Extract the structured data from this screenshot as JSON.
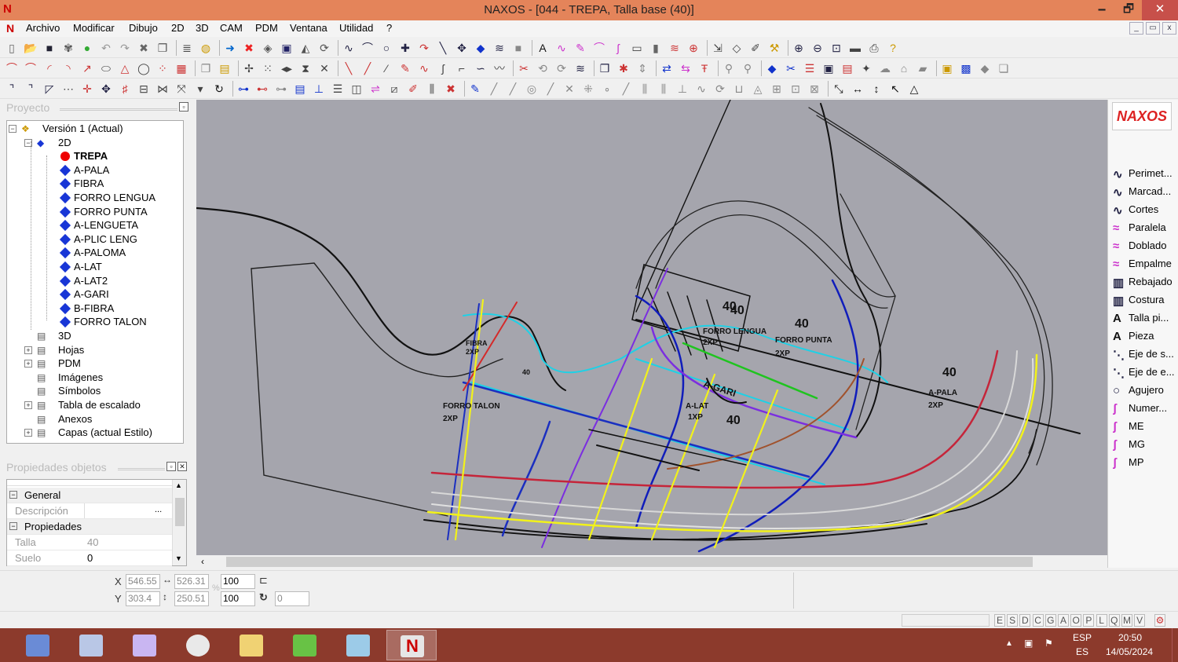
{
  "window": {
    "title": "NAXOS - [044 - TREPA, Talla base (40)]",
    "logo": "N",
    "min": "🗕",
    "max": "🗗",
    "close": "✕"
  },
  "menu": [
    "Archivo",
    "Modificar",
    "Dibujo",
    "2D",
    "3D",
    "CAM",
    "PDM",
    "Ventana",
    "Utilidad",
    "?"
  ],
  "mdi_buttons": [
    "_",
    "▭",
    "x"
  ],
  "project_panel": {
    "title": "Proyecto",
    "tree": [
      {
        "label": "Versión 1 (Actual)",
        "level": 0,
        "icon": "version-icon",
        "expander": "−"
      },
      {
        "label": "2D",
        "level": 1,
        "icon": "2d-icon",
        "expander": "−"
      },
      {
        "label": "TREPA",
        "level": 2,
        "icon": "red-dot-icon",
        "bold": true
      },
      {
        "label": "A-PALA",
        "level": 2,
        "icon": "blue-diamond-icon"
      },
      {
        "label": "FIBRA",
        "level": 2,
        "icon": "blue-diamond-icon"
      },
      {
        "label": "FORRO LENGUA",
        "level": 2,
        "icon": "blue-diamond-icon"
      },
      {
        "label": "FORRO PUNTA",
        "level": 2,
        "icon": "blue-diamond-icon"
      },
      {
        "label": "A-LENGUETA",
        "level": 2,
        "icon": "blue-diamond-icon"
      },
      {
        "label": "A-PLIC LENG",
        "level": 2,
        "icon": "blue-diamond-icon"
      },
      {
        "label": "A-PALOMA",
        "level": 2,
        "icon": "blue-diamond-icon"
      },
      {
        "label": "A-LAT",
        "level": 2,
        "icon": "blue-diamond-icon"
      },
      {
        "label": "A-LAT2",
        "level": 2,
        "icon": "blue-diamond-icon"
      },
      {
        "label": "A-GARI",
        "level": 2,
        "icon": "blue-diamond-icon"
      },
      {
        "label": "B-FIBRA",
        "level": 2,
        "icon": "blue-diamond-icon"
      },
      {
        "label": "FORRO TALON",
        "level": 2,
        "icon": "blue-diamond-icon"
      },
      {
        "label": "3D",
        "level": 1,
        "icon": "3d-icon"
      },
      {
        "label": "Hojas",
        "level": 1,
        "icon": "sheets-icon",
        "expander": "+"
      },
      {
        "label": "PDM",
        "level": 1,
        "icon": "pdm-icon",
        "expander": "+"
      },
      {
        "label": "Imágenes",
        "level": 1,
        "icon": "images-icon"
      },
      {
        "label": "Símbolos",
        "level": 1,
        "icon": "symbols-icon"
      },
      {
        "label": "Tabla de escalado",
        "level": 1,
        "icon": "scale-table-icon",
        "expander": "+"
      },
      {
        "label": "Anexos",
        "level": 1,
        "icon": "attachments-icon"
      },
      {
        "label": "Capas (actual Estilo)",
        "level": 1,
        "icon": "layers-icon",
        "expander": "+"
      }
    ]
  },
  "properties_panel": {
    "title": "Propiedades objetos",
    "sections": {
      "general": "General",
      "props": "Propiedades"
    },
    "fields": {
      "descripcion_label": "Descripción",
      "descripcion_value": "",
      "ellipsis": "...",
      "talla_label": "Talla",
      "talla_value": "40",
      "suelo_label": "Suelo",
      "suelo_value": "0"
    }
  },
  "right_panel": {
    "logo": "NAXOS",
    "items": [
      {
        "label": "Perimet...",
        "icon": "curve-icon"
      },
      {
        "label": "Marcad...",
        "icon": "curve-icon"
      },
      {
        "label": "Cortes",
        "icon": "curve-icon"
      },
      {
        "label": "Paralela",
        "icon": "parallel-icon"
      },
      {
        "label": "Doblado",
        "icon": "fold-icon"
      },
      {
        "label": "Empalme",
        "icon": "joint-icon"
      },
      {
        "label": "Rebajado",
        "icon": "pencils-icon"
      },
      {
        "label": "Costura",
        "icon": "pencils-icon"
      },
      {
        "label": "Talla pi...",
        "icon": "text-a-icon"
      },
      {
        "label": "Pieza",
        "icon": "text-a-icon"
      },
      {
        "label": "Eje de s...",
        "icon": "axis-icon"
      },
      {
        "label": "Eje de e...",
        "icon": "axis-icon"
      },
      {
        "label": "Agujero",
        "icon": "circle-icon"
      },
      {
        "label": "Numer...",
        "icon": "pen-icon"
      },
      {
        "label": "ME",
        "icon": "pen-icon"
      },
      {
        "label": "MG",
        "icon": "pen-icon"
      },
      {
        "label": "MP",
        "icon": "pen-icon"
      }
    ]
  },
  "canvas_labels": [
    {
      "text": "40",
      "cls": "size"
    },
    {
      "text": "40",
      "cls": "size"
    },
    {
      "text": "40",
      "cls": "size"
    },
    {
      "text": "40",
      "cls": "size"
    },
    {
      "text": "40",
      "cls": "size"
    },
    {
      "text": "40",
      "cls": "small"
    },
    {
      "text": "FORRO PUNTA",
      "cls": "piece"
    },
    {
      "text": "2XP",
      "cls": "piece"
    },
    {
      "text": "FORRO LENGUA",
      "cls": "piece"
    },
    {
      "text": "2XP",
      "cls": "piece"
    },
    {
      "text": "A-PALA",
      "cls": "piece"
    },
    {
      "text": "2XP",
      "cls": "piece"
    },
    {
      "text": "A-LAT",
      "cls": "piece"
    },
    {
      "text": "1XP",
      "cls": "piece"
    },
    {
      "text": "FORRO TALON",
      "cls": "piece"
    },
    {
      "text": "2XP",
      "cls": "piece"
    },
    {
      "text": "A-GARI",
      "cls": "piece"
    },
    {
      "text": "FIBRA",
      "cls": "piece"
    },
    {
      "text": "2XP",
      "cls": "piece"
    }
  ],
  "coords": {
    "x_label": "X",
    "y_label": "Y",
    "x": "546.55",
    "y": "303.4",
    "width": "526.31",
    "height": "250.51",
    "scale_x": "100",
    "scale_y": "100",
    "rotation": "0",
    "percent": "%"
  },
  "status_letters": [
    "E",
    "S",
    "D",
    "C",
    "G",
    "A",
    "O",
    "P",
    "L",
    "Q",
    "M",
    "V"
  ],
  "taskbar": {
    "apps": [
      "calculator-icon",
      "presentation-icon",
      "vector-editor-icon",
      "chrome-icon",
      "explorer-icon",
      "corel-icon",
      "notepad-icon",
      "naxos-icon"
    ],
    "lang_top": "ESP",
    "lang_bottom": "ES",
    "time": "20:50",
    "date": "14/05/2024"
  }
}
